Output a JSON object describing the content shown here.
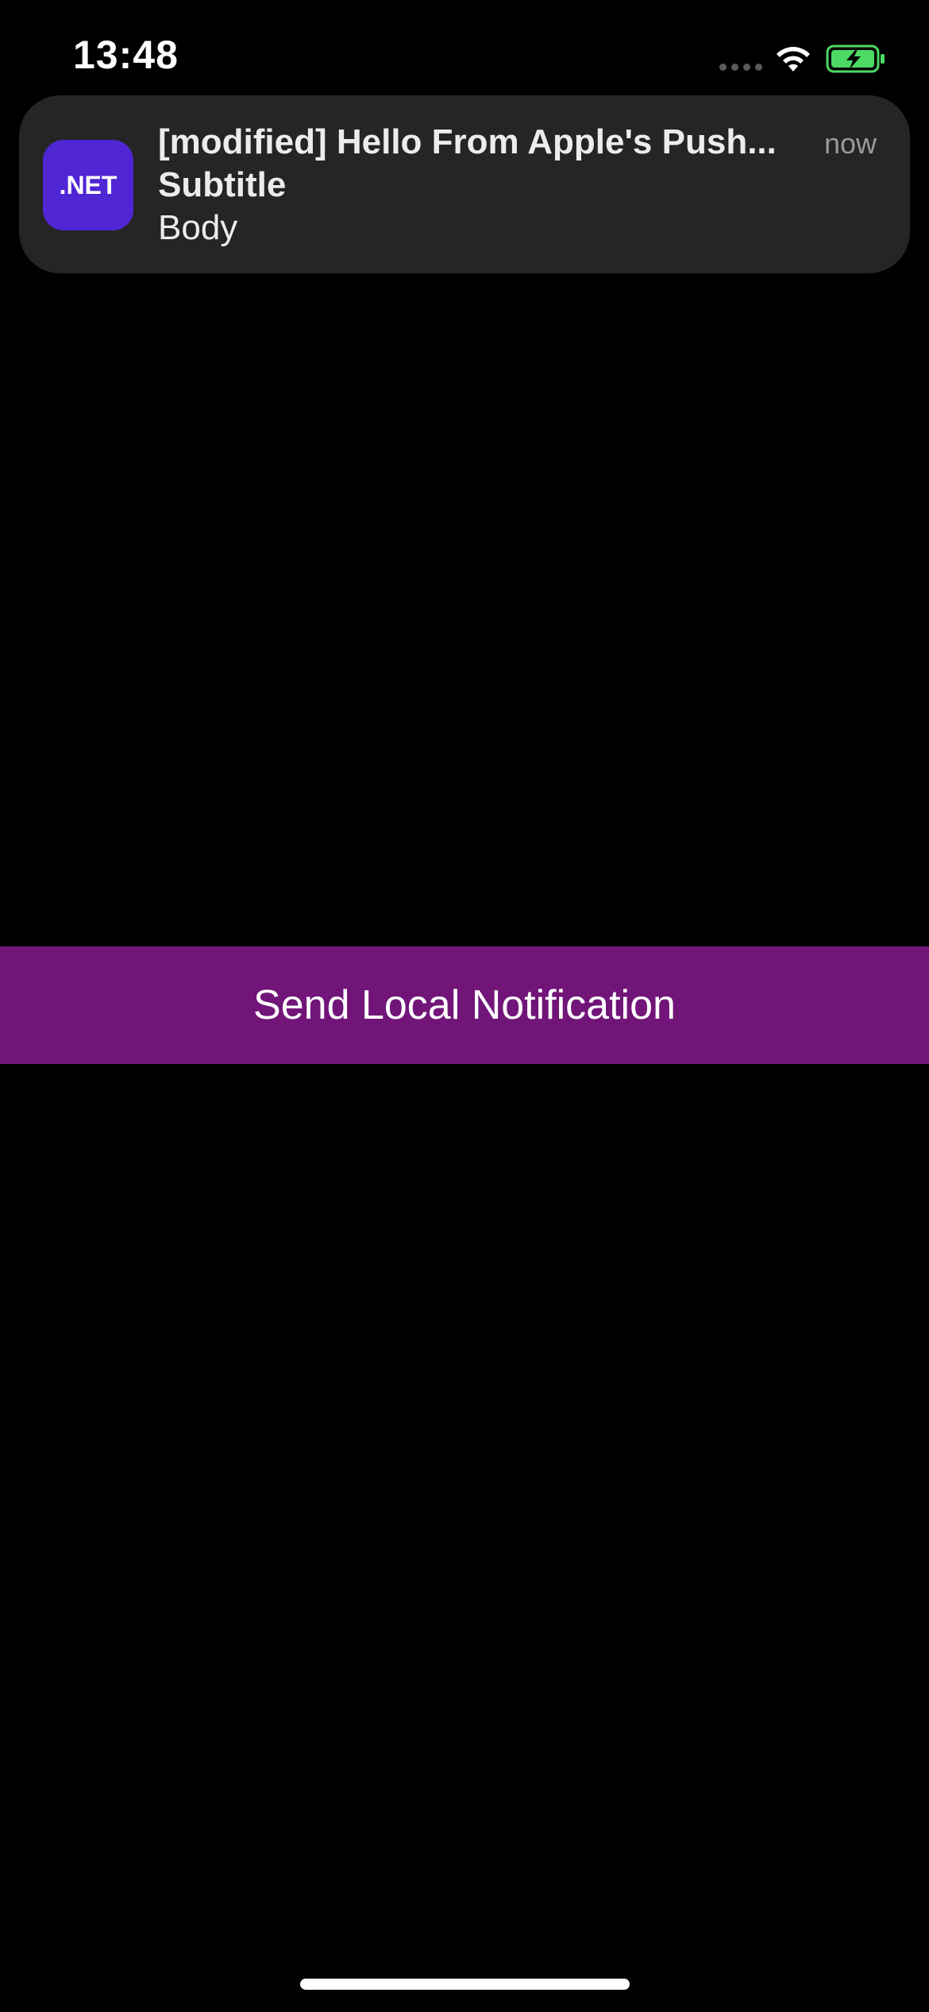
{
  "status_bar": {
    "time": "13:48",
    "icons": [
      "cellular-signal-icon",
      "wifi-icon",
      "battery-charging-icon"
    ]
  },
  "notification": {
    "app_icon_label": ".NET",
    "title": "[modified] Hello From Apple's Push...",
    "time": "now",
    "subtitle": "Subtitle",
    "body": "Body"
  },
  "main": {
    "send_button_label": "Send Local Notification"
  },
  "colors": {
    "background": "#000000",
    "notification_bg": "#252525",
    "app_icon_bg": "#5026d4",
    "button_bg": "#711579",
    "battery_green": "#4cd964"
  }
}
